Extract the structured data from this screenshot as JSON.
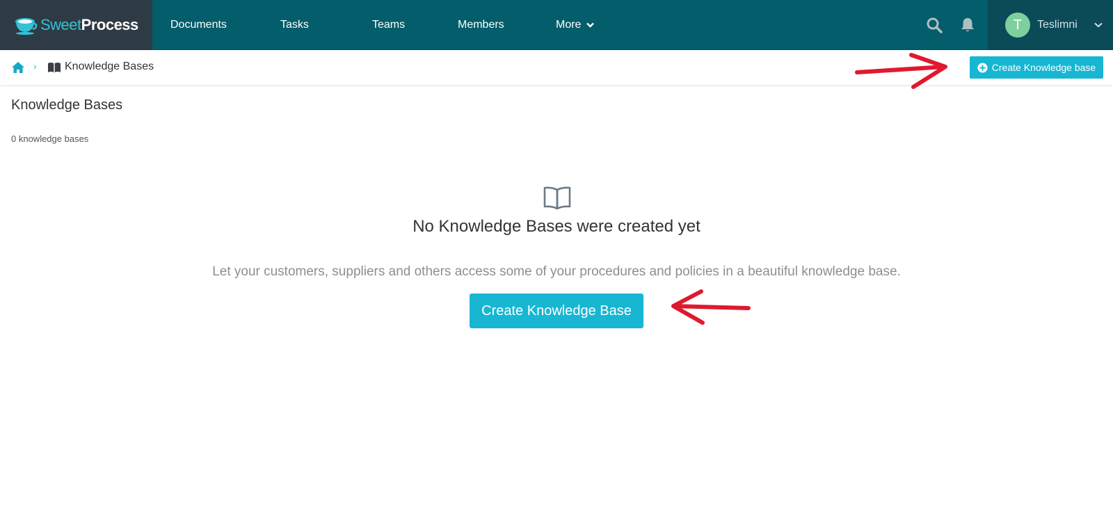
{
  "app": {
    "logo_sweet": "Sweet",
    "logo_process": "Process"
  },
  "nav": {
    "items": [
      {
        "label": "Documents"
      },
      {
        "label": "Tasks"
      },
      {
        "label": "Teams"
      },
      {
        "label": "Members"
      },
      {
        "label": "More"
      }
    ],
    "search_icon": "search-icon",
    "bell_icon": "bell-icon"
  },
  "user": {
    "initial": "T",
    "name": "Teslimni"
  },
  "breadcrumb": {
    "home_icon": "home-icon",
    "separator": "›",
    "book_icon": "book-icon",
    "current": "Knowledge Bases"
  },
  "toolbar": {
    "create_label": "Create Knowledge base"
  },
  "page": {
    "title": "Knowledge Bases",
    "count": "0 knowledge bases"
  },
  "empty_state": {
    "icon": "open-book-icon",
    "title": "No Knowledge Bases were created yet",
    "description": "Let your customers, suppliers and others access some of your procedures and policies in a beautiful knowledge base.",
    "button_label": "Create Knowledge Base"
  },
  "colors": {
    "nav_bg": "#035d6b",
    "logo_bg": "#2f3b44",
    "user_bg": "#0a4b57",
    "accent": "#17b6d2",
    "annotation": "#e0192e"
  }
}
